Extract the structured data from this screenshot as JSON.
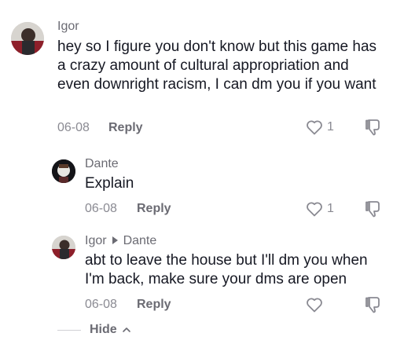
{
  "comments": [
    {
      "username": "Igor",
      "text": "hey so I figure you don't know but this game has a crazy amount of cultural appropriation and even downright racism, I can dm you if you want",
      "date": "06-08",
      "reply_label": "Reply",
      "likes": "1"
    },
    {
      "username": "Dante",
      "text": "Explain",
      "date": "06-08",
      "reply_label": "Reply",
      "likes": "1"
    },
    {
      "username": "Igor",
      "reply_to": "Dante",
      "text": "abt to leave the house but I'll dm you when I'm back, make sure your dms are open",
      "date": "06-08",
      "reply_label": "Reply",
      "likes": ""
    }
  ],
  "hide_label": "Hide"
}
